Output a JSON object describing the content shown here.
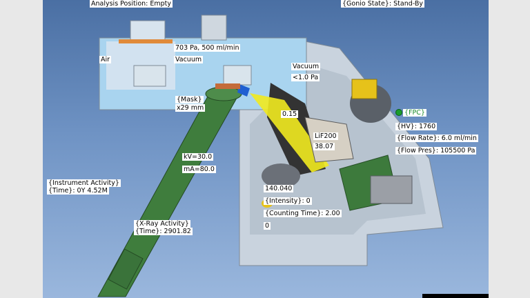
{
  "top": {
    "analysis_position": "Analysis Position:   Empty",
    "gonio_state": "{Gonio State}: Stand-By"
  },
  "chamber": {
    "pressure": "703 Pa, 500 ml/min",
    "air": "Air",
    "vacuum_left": "Vacuum",
    "vacuum_right": "Vacuum",
    "vacuum_pressure": "<1.0 Pa"
  },
  "mask": {
    "label": "{Mask}",
    "value": "x29 mm"
  },
  "goniometer": {
    "angle1": "0.15",
    "crystal": "LiF200",
    "angle2": "38.07",
    "two_theta": "140.040",
    "intensity": "{Intensity}: 0",
    "counting_time": "{Counting Time}: 2.00",
    "counter": "0"
  },
  "tube": {
    "kv": "kV=30.0",
    "ma": "mA=80.0"
  },
  "fpc": {
    "name": "{FPC}",
    "hv": "{HV}: 1760",
    "flow_rate": "{Flow Rate}: 6.0 ml/min",
    "flow_pres": "{Flow Pres}: 105500 Pa",
    "status_color": "#1a9d2c"
  },
  "instrument": {
    "activity": "{Instrument Activity}",
    "time": "{Time}: 0Y 4.52M"
  },
  "xray": {
    "activity": "{X-Ray Activity}",
    "time": "{Time}: 2901.82"
  }
}
